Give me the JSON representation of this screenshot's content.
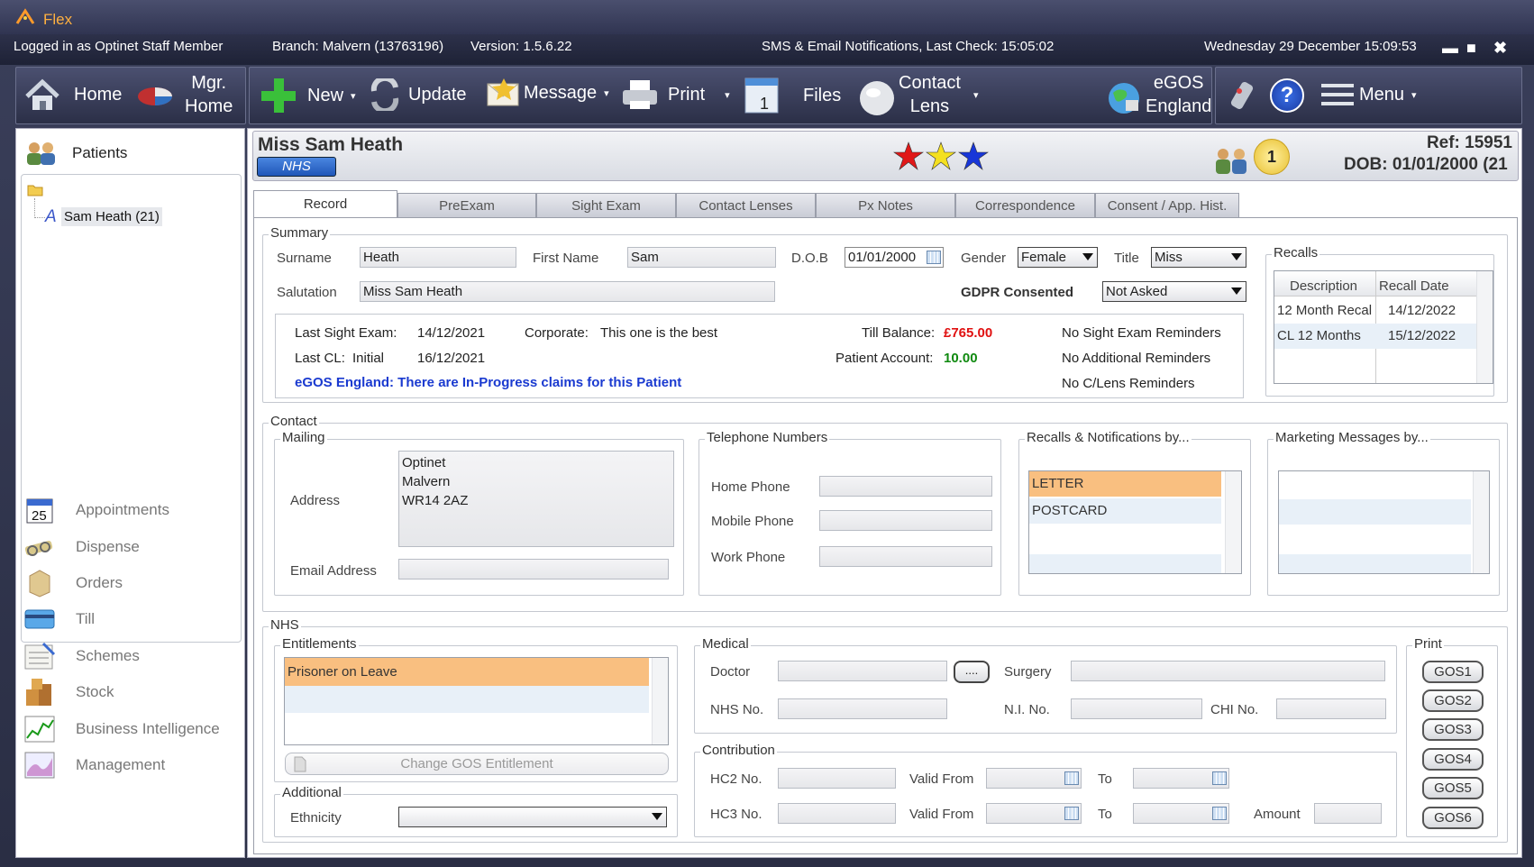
{
  "window": {
    "app_name": "Flex",
    "minimize": "▬",
    "maximize": "■",
    "close": "✖"
  },
  "status": {
    "logged_in": "Logged in as Optinet Staff Member",
    "branch": "Branch: Malvern (13763196)",
    "version": "Version: 1.5.6.22",
    "notifications": "SMS & Email Notifications, Last Check: 15:05:02",
    "datetime": "Wednesday 29 December 15:09:53"
  },
  "toolbar": {
    "home": "Home",
    "mgr_home_1": "Mgr.",
    "mgr_home_2": "Home",
    "new": "New",
    "update": "Update",
    "message": "Message",
    "print": "Print",
    "files": "Files",
    "contact_lens_1": "Contact",
    "contact_lens_2": "Lens",
    "egos_1": "eGOS",
    "egos_2": "England",
    "help": "?",
    "menu": "Menu",
    "caret": "▾"
  },
  "sidebar": {
    "patients": "Patients",
    "tree_patient": "Sam Heath (21)",
    "tree_letter": "A",
    "items": [
      "Appointments",
      "Dispense",
      "Orders",
      "Till",
      "Schemes",
      "Stock",
      "Business Intelligence",
      "Management"
    ],
    "calendar_day": "25"
  },
  "patient": {
    "name": "Miss Sam Heath",
    "badge": "NHS",
    "ref": "Ref: 15951",
    "dob_header": "DOB: 01/01/2000 (21",
    "coin": "1",
    "star_colors": [
      "#e01818",
      "#f4e020",
      "#1836d8"
    ]
  },
  "tabs": [
    "Record",
    "PreExam",
    "Sight Exam",
    "Contact Lenses",
    "Px Notes",
    "Correspondence",
    "Consent / App. Hist."
  ],
  "summary": {
    "legend": "Summary",
    "surname_label": "Surname",
    "surname": "Heath",
    "firstname_label": "First Name",
    "firstname": "Sam",
    "dob_label": "D.O.B",
    "dob": "01/01/2000",
    "gender_label": "Gender",
    "gender": "Female",
    "title_label": "Title",
    "title": "Miss",
    "salutation_label": "Salutation",
    "salutation": "Miss Sam Heath",
    "gdpr_label": "GDPR Consented",
    "gdpr": "Not Asked",
    "last_sight_label": "Last Sight Exam:",
    "last_sight": "14/12/2021",
    "corporate_label": "Corporate:",
    "corporate": "This one is the best",
    "till_label": "Till Balance:",
    "till": "£765.00",
    "reminder1": "No Sight Exam Reminders",
    "last_cl_label": "Last CL:",
    "last_cl_type": "Initial",
    "last_cl": "16/12/2021",
    "patient_account_label": "Patient Account:",
    "patient_account": "10.00",
    "reminder2": "No Additional Reminders",
    "egos_msg": "eGOS England: There are In-Progress claims for this Patient",
    "reminder3": "No C/Lens Reminders"
  },
  "recalls": {
    "legend": "Recalls",
    "col1": "Description",
    "col2": "Recall Date",
    "rows": [
      {
        "desc": "12 Month Recal",
        "date": "14/12/2022"
      },
      {
        "desc": "CL 12 Months",
        "date": "15/12/2022"
      }
    ]
  },
  "contact": {
    "legend": "Contact",
    "mailing": "Mailing",
    "address_label": "Address",
    "address": [
      "Optinet",
      "Malvern",
      "WR14 2AZ"
    ],
    "email_label": "Email Address",
    "tel_legend": "Telephone Numbers",
    "home_phone": "Home Phone",
    "mobile_phone": "Mobile Phone",
    "work_phone": "Work Phone",
    "recalls_by": "Recalls & Notifications by...",
    "recalls_by_items": [
      "LETTER",
      "POSTCARD"
    ],
    "marketing_by": "Marketing Messages by..."
  },
  "nhs": {
    "legend": "NHS",
    "entitlements": "Entitlements",
    "entitlement_item": "Prisoner on Leave",
    "change_gos": "Change GOS Entitlement",
    "additional": "Additional",
    "ethnicity": "Ethnicity",
    "medical": "Medical",
    "doctor": "Doctor",
    "dots": "....",
    "surgery": "Surgery",
    "nhs_no": "NHS No.",
    "ni_no": "N.I. No.",
    "chi_no": "CHI No.",
    "contribution": "Contribution",
    "hc2": "HC2 No.",
    "hc3": "HC3 No.",
    "valid_from": "Valid From",
    "to": "To",
    "amount": "Amount",
    "print": "Print",
    "gos": [
      "GOS1",
      "GOS2",
      "GOS3",
      "GOS4",
      "GOS5",
      "GOS6"
    ]
  }
}
